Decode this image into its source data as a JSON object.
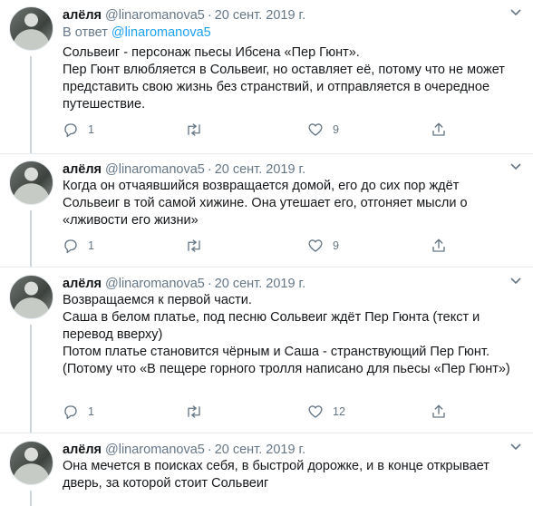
{
  "tweets": [
    {
      "author_name": "алёля",
      "handle": "@linaromanova5",
      "date": "20 сент. 2019 г.",
      "reply_prefix": "В ответ",
      "reply_mention": "@linaromanova5",
      "lines": [
        "Сольвеиг - персонаж пьесы Ибсена «Пер Гюнт».",
        "Пер Гюнт влюбляется в Сольвеиг, но оставляет её, потому что не может представить свою жизнь без странствий, и отправляется в очередное путешествие."
      ],
      "reply_count": "1",
      "retweet_count": "",
      "like_count": "9"
    },
    {
      "author_name": "алёля",
      "handle": "@linaromanova5",
      "date": "20 сент. 2019 г.",
      "lines": [
        "Когда он отчаявшийся возвращается домой, его до сих пор ждёт Сольвеиг в той самой хижине. Она утешает его, отгоняет мысли о «лживости его жизни»"
      ],
      "reply_count": "1",
      "retweet_count": "",
      "like_count": "9"
    },
    {
      "author_name": "алёля",
      "handle": "@linaromanova5",
      "date": "20 сент. 2019 г.",
      "lines": [
        "Возвращаемся к первой части.",
        "Саша в белом платье, под песню Сольвеиг ждёт Пер Гюнта (текст и перевод вверху)",
        "Потом платье становится чёрным и Саша - странствующий Пер Гюнт.",
        "(Потому что «В пещере горного тролля написано для пьесы «Пер Гюнт»)"
      ],
      "reply_count": "1",
      "retweet_count": "",
      "like_count": "12"
    },
    {
      "author_name": "алёля",
      "handle": "@linaromanova5",
      "date": "20 сент. 2019 г.",
      "lines": [
        "Она мечется в поисках себя, в быстрой дорожке, и в конце открывает дверь, за которой стоит Сольвеиг"
      ]
    }
  ],
  "colors": {
    "text": "#14171a",
    "secondary": "#657786",
    "link": "#1da1f2",
    "divider": "#e6ecf0",
    "thread_line": "#ccd6dd"
  },
  "icons": [
    "reply-icon",
    "retweet-icon",
    "like-icon",
    "share-icon",
    "chevron-down-icon"
  ]
}
